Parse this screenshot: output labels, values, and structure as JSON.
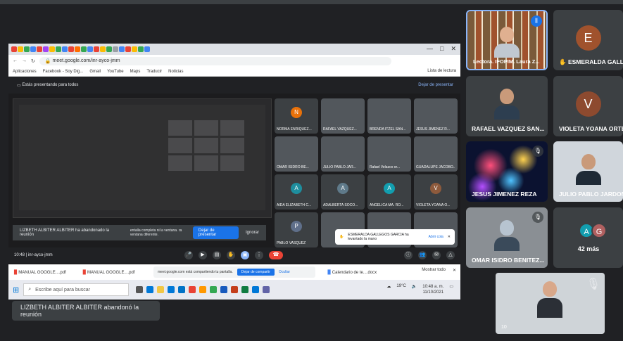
{
  "browser": {
    "url": "meet.google.com/inr-ayco-jmm",
    "bookmarks": [
      "Aplicaciones",
      "Facebook - Soy Dig...",
      "Gmail",
      "YouTube",
      "Maps",
      "Traducir",
      "Noticias"
    ],
    "reading_list": "Lista de lectura",
    "window_controls": [
      "—",
      "□",
      "✕"
    ]
  },
  "shared_screen": {
    "presenting_text": "Estás presentando para todos",
    "stop_presenting": "Dejar de presentar",
    "inner_tiles": [
      {
        "name": "NORMA ENRIQUEZ...",
        "avatar": "N",
        "color": "#e8710a"
      },
      {
        "name": "RAFAEL VAZQUEZ...",
        "avatar": "",
        "color": "#5f6368"
      },
      {
        "name": "BRENDA ITZEL SAN...",
        "avatar": "",
        "color": "#5f6368"
      },
      {
        "name": "JESUS JIMENEZ R...",
        "avatar": "",
        "color": "#5f6368"
      },
      {
        "name": "OMAR ISIDRO BE...",
        "avatar": "",
        "color": "#5f6368"
      },
      {
        "name": "JULIO PABLO JAR...",
        "avatar": "",
        "color": "#5f6368"
      },
      {
        "name": "Rafael Velazco or...",
        "avatar": "",
        "color": "#5f6368"
      },
      {
        "name": "GUADALUPE JACOBO...",
        "avatar": "",
        "color": "#5f6368"
      },
      {
        "name": "AIDA ELIZABETH C...",
        "avatar": "A",
        "color": "#1e8e9e"
      },
      {
        "name": "ADALBERTA SOCO...",
        "avatar": "A",
        "color": "#5f7a8a"
      },
      {
        "name": "ANGELICA MA. RO...",
        "avatar": "A",
        "color": "#129eaf"
      },
      {
        "name": "VIOLETA YOANA O...",
        "avatar": "V",
        "color": "#8d5a3c"
      },
      {
        "name": "PABLO VASQUEZ",
        "avatar": "P",
        "color": "#5f6f8a"
      },
      {
        "name": "",
        "avatar": "",
        "color": "#5f6368"
      },
      {
        "name": "",
        "avatar": "",
        "color": "#5f6368"
      },
      {
        "name": "",
        "avatar": "",
        "color": "#5f6368"
      }
    ],
    "leave_banner": {
      "text": "LIZBETH ALBITER ALBITER ha abandonado la reunión",
      "detail": "entalla completa ni la ventana. ra ventana diferente.",
      "primary": "Dejar de presentar",
      "secondary": "Ignorar"
    },
    "hand_notice": {
      "text": "ESMERALDA GALLEGOS GARCIA ha levantado la mano",
      "open": "Abrir cola"
    },
    "meeting_time": "10:48",
    "meeting_code": "inr-ayco-jmm",
    "downloads": [
      {
        "name": "MANUAL GOOGLE....pdf"
      },
      {
        "name": "MANUAL GOOGLE....pdf"
      },
      {
        "name": "Calendario de te....docx"
      }
    ],
    "share_notice": {
      "text": "meet.google.com está compartiendo tu pantalla.",
      "stop": "Dejar de compartir",
      "hide": "Ocultar"
    },
    "show_all": "Mostrar todo",
    "taskbar": {
      "search_placeholder": "Escribe aquí para buscar",
      "temperature": "19°C",
      "time": "10:48 a. m.",
      "date": "11/10/2021"
    }
  },
  "toast": "LIZBETH ALBITER ALBITER abandonó la reunión",
  "tiles": [
    {
      "name": "Lectora. IFOPIM. Laura Z...",
      "type": "bookshelf"
    },
    {
      "name": "ESMERALDA GALLEG...",
      "type": "avatar",
      "letter": "E",
      "color": "#a0522d",
      "badge": "✋"
    },
    {
      "name": "RAFAEL VAZQUEZ SAN...",
      "type": "photo"
    },
    {
      "name": "VIOLETA YOANA ORTE...",
      "type": "avatar",
      "letter": "V",
      "color": "#8d4a2f"
    },
    {
      "name": "JESUS JIMENEZ REZA",
      "type": "fireworks"
    },
    {
      "name": "JULIO PABLO JARDON",
      "type": "photo"
    },
    {
      "name": "OMAR ISIDRO BENITEZ...",
      "type": "photo"
    }
  ],
  "more": {
    "letters": [
      "A",
      "G"
    ],
    "colors": [
      "#129eaf",
      "#b06060"
    ],
    "count": "42 más"
  },
  "self_view": {
    "label": "10"
  }
}
